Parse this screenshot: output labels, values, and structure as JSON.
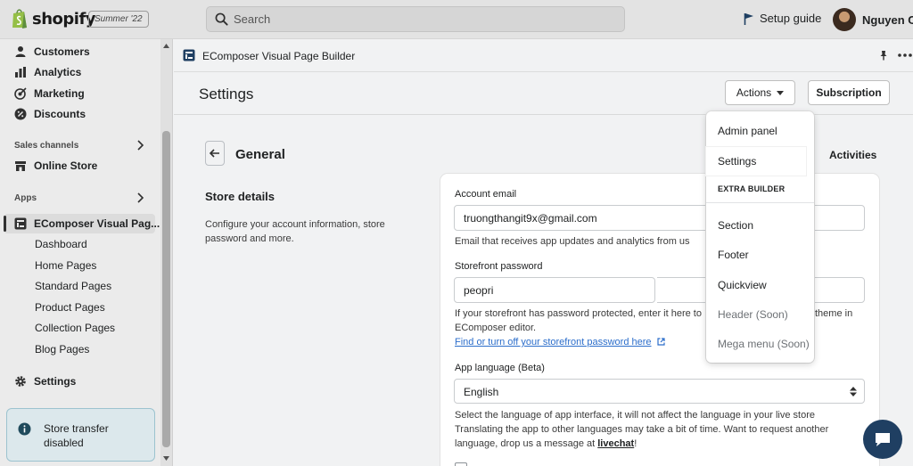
{
  "topbar": {
    "logo_text": "shopify",
    "edition": "Summer '22",
    "search_placeholder": "Search",
    "setup_guide": "Setup guide",
    "user_name": "Nguyen Co"
  },
  "sidebar": {
    "items": [
      {
        "label": "Customers",
        "icon": "person-icon"
      },
      {
        "label": "Analytics",
        "icon": "bar-chart-icon"
      },
      {
        "label": "Marketing",
        "icon": "target-icon"
      },
      {
        "label": "Discounts",
        "icon": "discount-icon"
      }
    ],
    "sales_channels_label": "Sales channels",
    "online_store": "Online Store",
    "apps_label": "Apps",
    "app_name": "EComposer Visual Pag...",
    "app_subitems": [
      "Dashboard",
      "Home Pages",
      "Standard Pages",
      "Product Pages",
      "Collection Pages",
      "Blog Pages"
    ],
    "settings": "Settings",
    "store_transfer": "Store transfer disabled"
  },
  "app_header": {
    "title": "EComposer Visual Page Builder"
  },
  "settings_header": {
    "title": "Settings",
    "actions_label": "Actions",
    "subscription_label": "Subscription"
  },
  "main": {
    "section_title": "General",
    "activities": "Activities",
    "store_details_title": "Store details",
    "store_details_desc": "Configure your account information, store password and more.",
    "account_email_label": "Account email",
    "account_email_value": "truongthangit9x@gmail.com",
    "account_email_help": "Email that receives app updates and analytics from us",
    "storefront_password_label": "Storefront password",
    "storefront_password_value": "peopri",
    "storefront_help_1": "If your storefront has password protected, enter it here to",
    "storefront_help_1b": "theme in",
    "storefront_help_2": "EComposer editor.",
    "storefront_link": "Find or turn off your storefront password here",
    "app_language_label": "App language (Beta)",
    "app_language_value": "English",
    "language_help_1": "Select the language of app interface, it will not affect the language in your live store",
    "language_help_2": "Translating the app to other languages may take a bit of time. Want to request another",
    "language_help_3": "language, drop us a message at",
    "livechat": "livechat",
    "language_help_end": "!"
  },
  "dropdown": {
    "admin_panel": "Admin panel",
    "settings": "Settings",
    "extra_builder": "EXTRA BUILDER",
    "section": "Section",
    "footer": "Footer",
    "quickview": "Quickview",
    "header_soon": "Header (Soon)",
    "mega_menu_soon": "Mega menu (Soon)"
  }
}
